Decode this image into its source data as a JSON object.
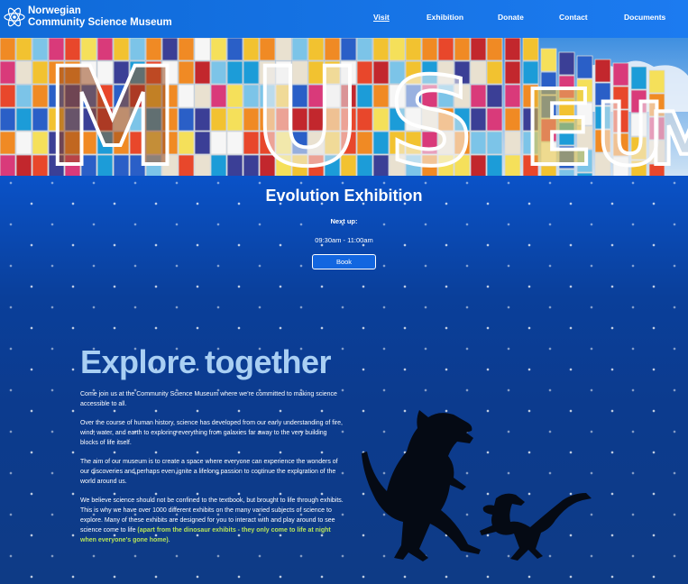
{
  "header": {
    "brand_line1": "Norwegian",
    "brand_line2": "Community Science Museum",
    "logo_icon": "atom-icon",
    "nav": [
      "Visit",
      "Exhibition",
      "Donate",
      "Contact",
      "Documents"
    ],
    "active_nav": "Visit"
  },
  "hero": {
    "letters": [
      "M",
      "U",
      "S",
      "E",
      "U",
      "M"
    ]
  },
  "exhibition": {
    "title": "Evolution Exhibition",
    "next_label": "Next up:",
    "time": "09:30am - 11:00am",
    "book_label": "Book"
  },
  "explore": {
    "title": "Explore together",
    "p1": "Come join us at the Community Science Museum where we're committed to making science accessible to all.",
    "p2": "Over the course of human history, science has developed from our early understanding of fire, wind, water, and earth to exploring everything from galaxies far away to the very building blocks of life itself.",
    "p3": "The aim of our museum is to create a space where everyone can experience the wonders of our discoveries and perhaps even ignite a lifelong passion to continue the exploration of the world around us.",
    "p4_main": "We believe science should not be confined to the textbook, but brought to life through exhibits. This is why we have over 1000 different exhibits on the many varied subjects of science to explore. Many of these exhibits are designed for you to interact with and play around to see science come to life ",
    "p4_highlight": "(apart from the dinosaur exhibits - they only come to life at night when everyone's gone home)",
    "p4_end": "."
  },
  "colors": {
    "nav_bg": "#1570e6",
    "page_bg": "#0b3d8f",
    "title_accent": "#a9cff3",
    "highlight": "#b7e35a"
  }
}
